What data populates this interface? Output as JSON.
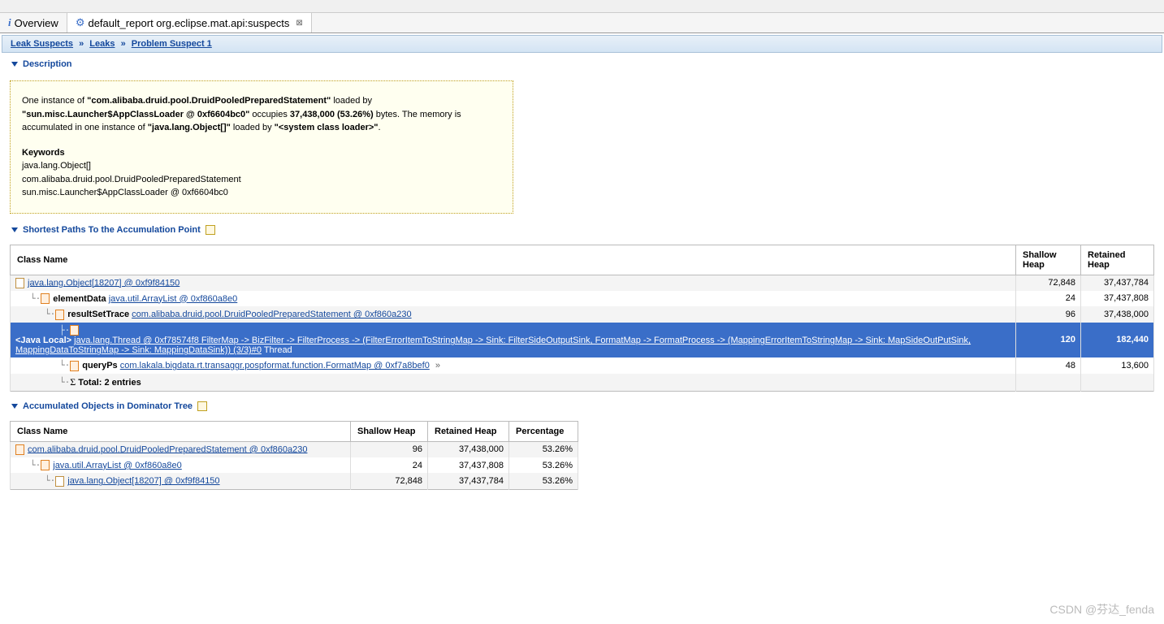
{
  "tabs": {
    "overview": "Overview",
    "report": "default_report   org.eclipse.mat.api:suspects"
  },
  "breadcrumb": {
    "a": "Leak Suspects",
    "b": "Leaks",
    "c": "Problem Suspect 1"
  },
  "section1": "Description",
  "desc": {
    "t1a": "One instance of ",
    "t1b": "\"com.alibaba.druid.pool.DruidPooledPreparedStatement\"",
    "t1c": " loaded by ",
    "t1d": "\"sun.misc.Launcher$AppClassLoader @ 0xf6604bc0\"",
    "t1e": " occupies ",
    "t1f": "37,438,000 (53.26%)",
    "t1g": " bytes. The memory is accumulated in one instance of ",
    "t1h": "\"java.lang.Object[]\"",
    "t1i": " loaded by ",
    "t1j": "\"<system class loader>\"",
    "t1k": ".",
    "kwhead": "Keywords",
    "kw1": "java.lang.Object[]",
    "kw2": "com.alibaba.druid.pool.DruidPooledPreparedStatement",
    "kw3": "sun.misc.Launcher$AppClassLoader @ 0xf6604bc0"
  },
  "section2": "Shortest Paths To the Accumulation Point",
  "t1": {
    "h1": "Class Name",
    "h2": "Shallow Heap",
    "h3": "Retained Heap",
    "r0": {
      "name": "java.lang.Object[18207] @ 0xf9f84150",
      "sh": "72,848",
      "rh": "37,437,784"
    },
    "r1": {
      "prefix": "elementData ",
      "link": "java.util.ArrayList @ 0xf860a8e0",
      "sh": "24",
      "rh": "37,437,808"
    },
    "r2": {
      "prefix": "resultSetTrace ",
      "link": "com.alibaba.druid.pool.DruidPooledPreparedStatement @ 0xf860a230",
      "sh": "96",
      "rh": "37,438,000"
    },
    "r3": {
      "prefix": "<Java Local> ",
      "link": "java.lang.Thread @ 0xf78574f8 FilterMap -> BizFilter -> FilterProcess -> (FilterErrorItemToStringMap -> Sink: FilterSideOutputSink, FormatMap -> FormatProcess -> (MappingErrorItemToStringMap -> Sink: MapSideOutPutSink, MappingDataToStringMap -> Sink: MappingDataSink)) (3/3)#0",
      "suffix": " Thread",
      "sh": "120",
      "rh": "182,440"
    },
    "r4": {
      "prefix": "queryPs ",
      "link": "com.lakala.bigdata.rt.transaggr.pospformat.function.FormatMap @ 0xf7a8bef0",
      "suffix": " »",
      "sh": "48",
      "rh": "13,600"
    },
    "total": "Total: 2 entries"
  },
  "section3": "Accumulated Objects in Dominator Tree",
  "t2": {
    "h1": "Class Name",
    "h2": "Shallow Heap",
    "h3": "Retained Heap",
    "h4": "Percentage",
    "r0": {
      "link": "com.alibaba.druid.pool.DruidPooledPreparedStatement @ 0xf860a230",
      "sh": "96",
      "rh": "37,438,000",
      "pc": "53.26%"
    },
    "r1": {
      "link": "java.util.ArrayList @ 0xf860a8e0",
      "sh": "24",
      "rh": "37,437,808",
      "pc": "53.26%"
    },
    "r2": {
      "link": "java.lang.Object[18207] @ 0xf9f84150",
      "sh": "72,848",
      "rh": "37,437,784",
      "pc": "53.26%"
    }
  },
  "watermark": "CSDN @芬达_fenda"
}
